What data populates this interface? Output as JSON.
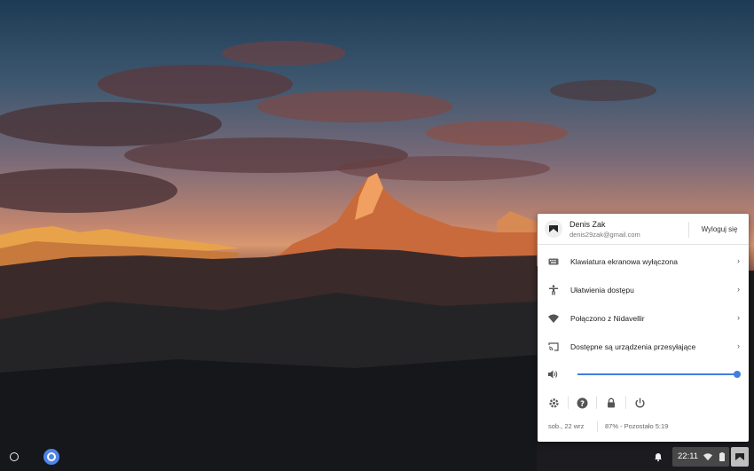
{
  "tray": {
    "user": {
      "name": "Denis Zak",
      "email": "denis29zak@gmail.com",
      "sign_out": "Wyloguj się"
    },
    "rows": [
      {
        "label": "Klawiatura ekranowa wyłączona",
        "icon": "keyboard-icon"
      },
      {
        "label": "Ułatwienia dostępu",
        "icon": "accessibility-icon"
      },
      {
        "label": "Połączono z Nidavellir",
        "icon": "wifi-icon"
      },
      {
        "label": "Dostępne są urządzenia przesyłające",
        "icon": "cast-icon"
      }
    ],
    "volume": {
      "level": 1.0
    },
    "buttons": [
      "settings-icon",
      "help-icon",
      "lock-icon",
      "power-icon"
    ],
    "date": "sob., 22 wrz",
    "battery": "87% - Pozostało 5:19"
  },
  "shelf": {
    "clock": "22:11"
  },
  "colors": {
    "accent": "#3f7fe0",
    "tray_bg": "#ffffff"
  }
}
